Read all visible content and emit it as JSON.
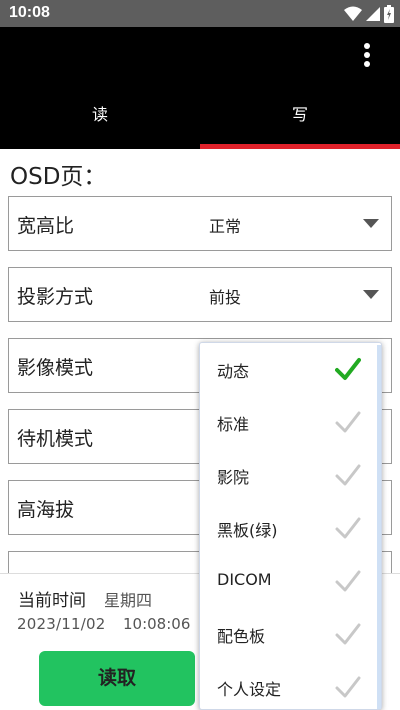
{
  "status_bar": {
    "time": "10:08"
  },
  "tabs": [
    {
      "label": "读",
      "active": false
    },
    {
      "label": "写",
      "active": true
    }
  ],
  "section": {
    "title": "OSD页："
  },
  "settings": [
    {
      "label": "宽高比",
      "value": "正常"
    },
    {
      "label": "投影方式",
      "value": "前投"
    },
    {
      "label": "影像模式",
      "value": ""
    },
    {
      "label": "待机模式",
      "value": ""
    },
    {
      "label": "高海拔",
      "value": ""
    },
    {
      "label": "",
      "value": ""
    }
  ],
  "footer": {
    "current_time_label": "当前时间",
    "weekday": "星期四",
    "date": "2023/11/02",
    "time": "10:08:06",
    "read_button": "读取"
  },
  "dropdown": {
    "selected": "动态",
    "options": [
      {
        "label": "动态",
        "checked": true
      },
      {
        "label": "标准",
        "checked": false
      },
      {
        "label": "影院",
        "checked": false
      },
      {
        "label": "黑板(绿)",
        "checked": false
      },
      {
        "label": "DICOM",
        "checked": false
      },
      {
        "label": "配色板",
        "checked": false
      },
      {
        "label": "个人设定",
        "checked": false
      }
    ]
  },
  "colors": {
    "accent": "#e1222b",
    "button": "#22c360",
    "check_active": "#22aa22",
    "check_inactive": "#c8c8c8"
  }
}
